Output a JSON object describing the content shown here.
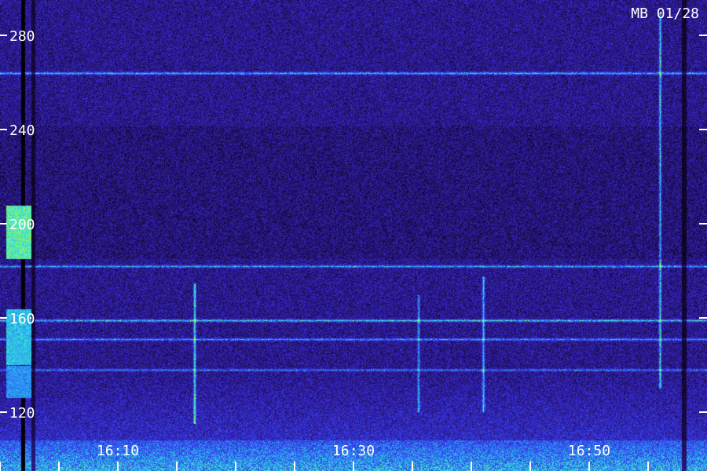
{
  "chart_data": {
    "type": "heatmap",
    "title": "MB 01/28",
    "xlabel": "",
    "ylabel": "",
    "y_ticks": [
      "280",
      "240",
      "200",
      "160",
      "120"
    ],
    "y_tick_values": [
      280,
      240,
      200,
      160,
      120
    ],
    "x_ticks": [
      "16:10",
      "16:30",
      "16:50"
    ],
    "x_tick_minutes": [
      10,
      30,
      50
    ],
    "x_minor_ticks": [
      0,
      5,
      10,
      15,
      20,
      25,
      30,
      35,
      40,
      45,
      50,
      55
    ],
    "ylim": [
      110,
      294
    ],
    "xlim_minutes": [
      0,
      58
    ],
    "colormap": [
      "#000000",
      "#1a0a4a",
      "#2a1b8c",
      "#3a2ad8",
      "#2f5cf5",
      "#2bb6f0",
      "#3cf0c8",
      "#b8f040"
    ],
    "horizontal_bands": [
      {
        "y": 264,
        "level": 0.55
      },
      {
        "y": 182,
        "level": 0.5
      },
      {
        "y": 159,
        "level": 0.6
      },
      {
        "y": 151,
        "level": 0.45
      },
      {
        "y": 138,
        "level": 0.4
      }
    ],
    "vertical_bursts": [
      {
        "minute": 16.5,
        "y_from": 115,
        "y_to": 175,
        "level": 0.7
      },
      {
        "minute": 35.5,
        "y_from": 120,
        "y_to": 170,
        "level": 0.5
      },
      {
        "minute": 41,
        "y_from": 120,
        "y_to": 178,
        "level": 0.55
      },
      {
        "minute": 56,
        "y_from": 130,
        "y_to": 290,
        "level": 0.6
      }
    ],
    "intense_columns": [
      {
        "minute": 1.2,
        "y_from": 185,
        "y_to": 208,
        "level": 1.0
      },
      {
        "minute": 1.2,
        "y_from": 140,
        "y_to": 164,
        "level": 0.85
      },
      {
        "minute": 1.2,
        "y_from": 126,
        "y_to": 140,
        "level": 0.75
      }
    ]
  }
}
